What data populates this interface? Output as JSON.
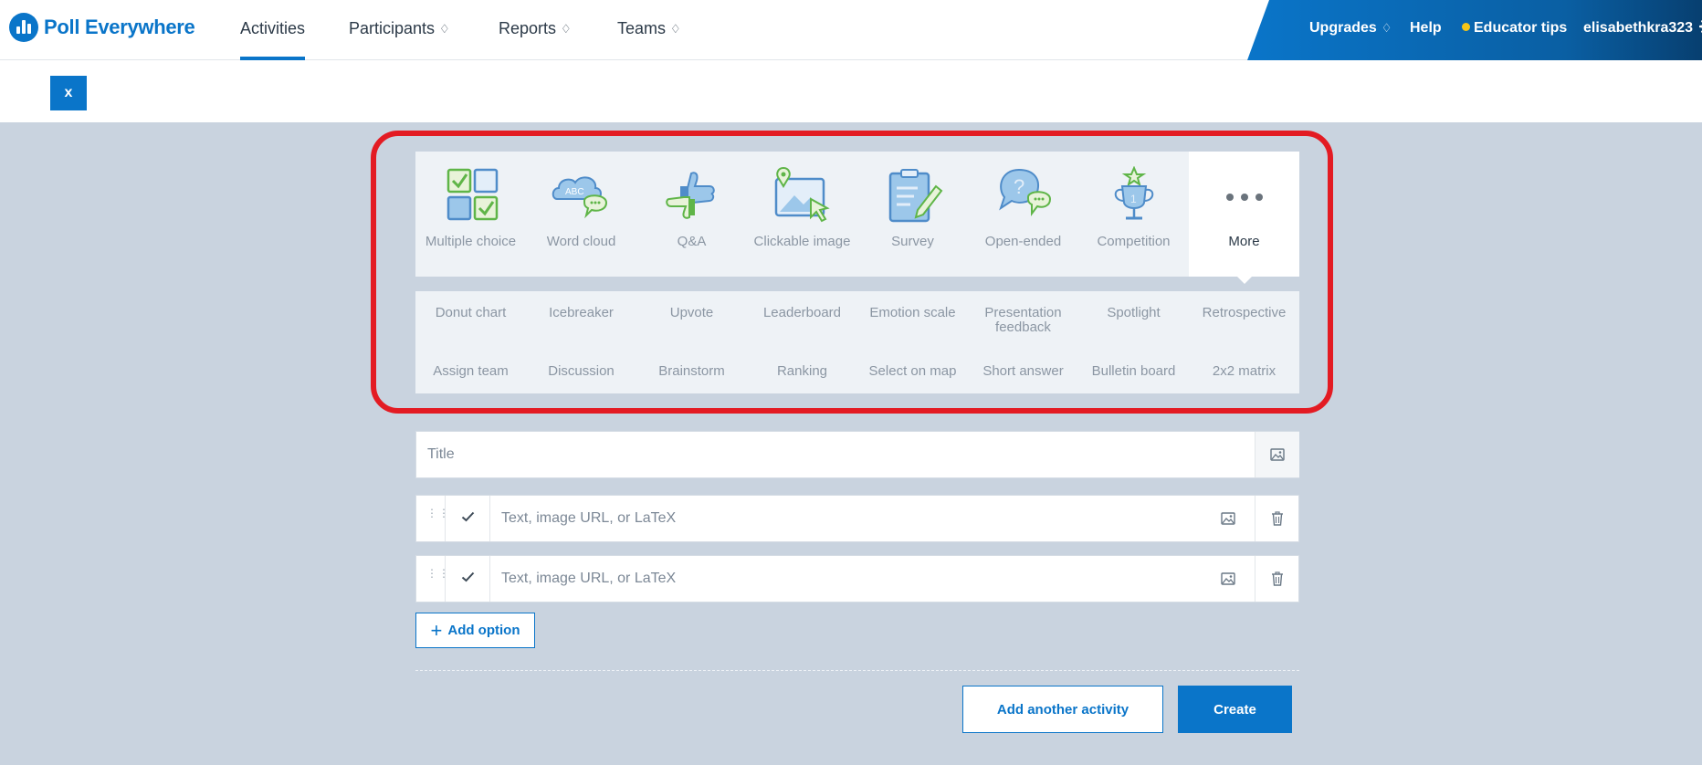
{
  "brand": {
    "name": "Poll Everywhere",
    "logo_icon": "poll-everywhere-logo-icon"
  },
  "nav": {
    "tabs": [
      {
        "label": "Activities",
        "active": true
      },
      {
        "label": "Participants",
        "icon": "diamond-icon"
      },
      {
        "label": "Reports",
        "icon": "diamond-icon"
      },
      {
        "label": "Teams",
        "icon": "diamond-icon"
      }
    ],
    "right": {
      "upgrades": "Upgrades",
      "help": "Help",
      "educator_tips": "Educator tips",
      "username": "elisabethkra323",
      "settings_icon": "gear-icon"
    }
  },
  "subbar": {
    "close_label": "x"
  },
  "activity_types": [
    {
      "label": "Multiple choice",
      "icon": "multiple-choice-icon"
    },
    {
      "label": "Word cloud",
      "icon": "word-cloud-icon"
    },
    {
      "label": "Q&A",
      "icon": "thumbs-up-down-icon"
    },
    {
      "label": "Clickable image",
      "icon": "clickable-image-icon"
    },
    {
      "label": "Survey",
      "icon": "survey-clipboard-icon"
    },
    {
      "label": "Open-ended",
      "icon": "open-ended-bubbles-icon"
    },
    {
      "label": "Competition",
      "icon": "trophy-icon"
    },
    {
      "label": "More",
      "icon": "more-dots-icon",
      "selected": true
    }
  ],
  "more_types": {
    "row1": [
      "Donut chart",
      "Icebreaker",
      "Upvote",
      "Leaderboard",
      "Emotion scale",
      "Presentation feedback",
      "Spotlight",
      "Retrospective"
    ],
    "row2": [
      "Assign team",
      "Discussion",
      "Brainstorm",
      "Ranking",
      "Select on map",
      "Short answer",
      "Bulletin board",
      "2x2 matrix"
    ]
  },
  "form": {
    "title_placeholder": "Title",
    "option_placeholder": "Text, image URL, or LaTeX",
    "add_option_label": "Add option"
  },
  "footer": {
    "add_another_label": "Add another activity",
    "create_label": "Create"
  },
  "colors": {
    "accent": "#0a75c9",
    "highlight": "#e31b23",
    "canvas": "#c9d3df",
    "icon_green": "#5fb548",
    "icon_blue": "#9cc7ea"
  }
}
